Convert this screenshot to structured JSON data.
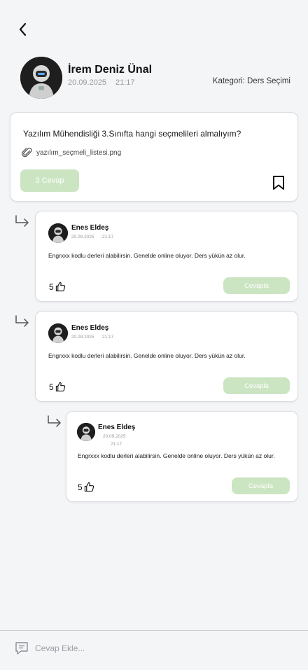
{
  "post": {
    "author_name": "İrem Deniz Ünal",
    "date": "20.09.2025",
    "time": "21:17",
    "category": "Kategori: Ders Seçimi",
    "question": "Yazılım Mühendisliği 3.Sınıfta hangi seçmelileri almalıyım?",
    "attachment": "yazılım_seçmeli_listesi.png",
    "answer_count_label": "3  Cevap"
  },
  "replies": [
    {
      "name": "Enes Eldeş",
      "date": "20.09.2025",
      "time": "21:17",
      "body": "Engrxxx kodlu derleri alabilirsin. Genelde online oluyor. Ders yükün az olur.",
      "likes": "5",
      "reply_label": "Cevapla"
    },
    {
      "name": "Enes Eldeş",
      "date": "20.09.2025",
      "time": "21:17",
      "body": "Engrxxx kodlu derleri alabilirsin. Genelde online oluyor. Ders yükün az olur.",
      "likes": "5",
      "reply_label": "Cevapla"
    },
    {
      "name": "Enes Eldeş",
      "date": "20.09.2025",
      "time": "21:17",
      "body": "Engrxxx kodlu derleri alabilirsin. Genelde online oluyor. Ders yükün az olur.",
      "likes": "5",
      "reply_label": "Cevapla"
    }
  ],
  "composer": {
    "placeholder": "Cevap Ekle..."
  },
  "colors": {
    "accent_green": "#cbe5c2",
    "background": "#f4f5f7"
  },
  "icons": {
    "back": "chevron-left-icon",
    "attachment": "paperclip-icon",
    "bookmark": "bookmark-icon",
    "reply_arrow": "reply-arrow-icon",
    "like": "thumbs-up-icon",
    "comment": "comment-icon"
  }
}
